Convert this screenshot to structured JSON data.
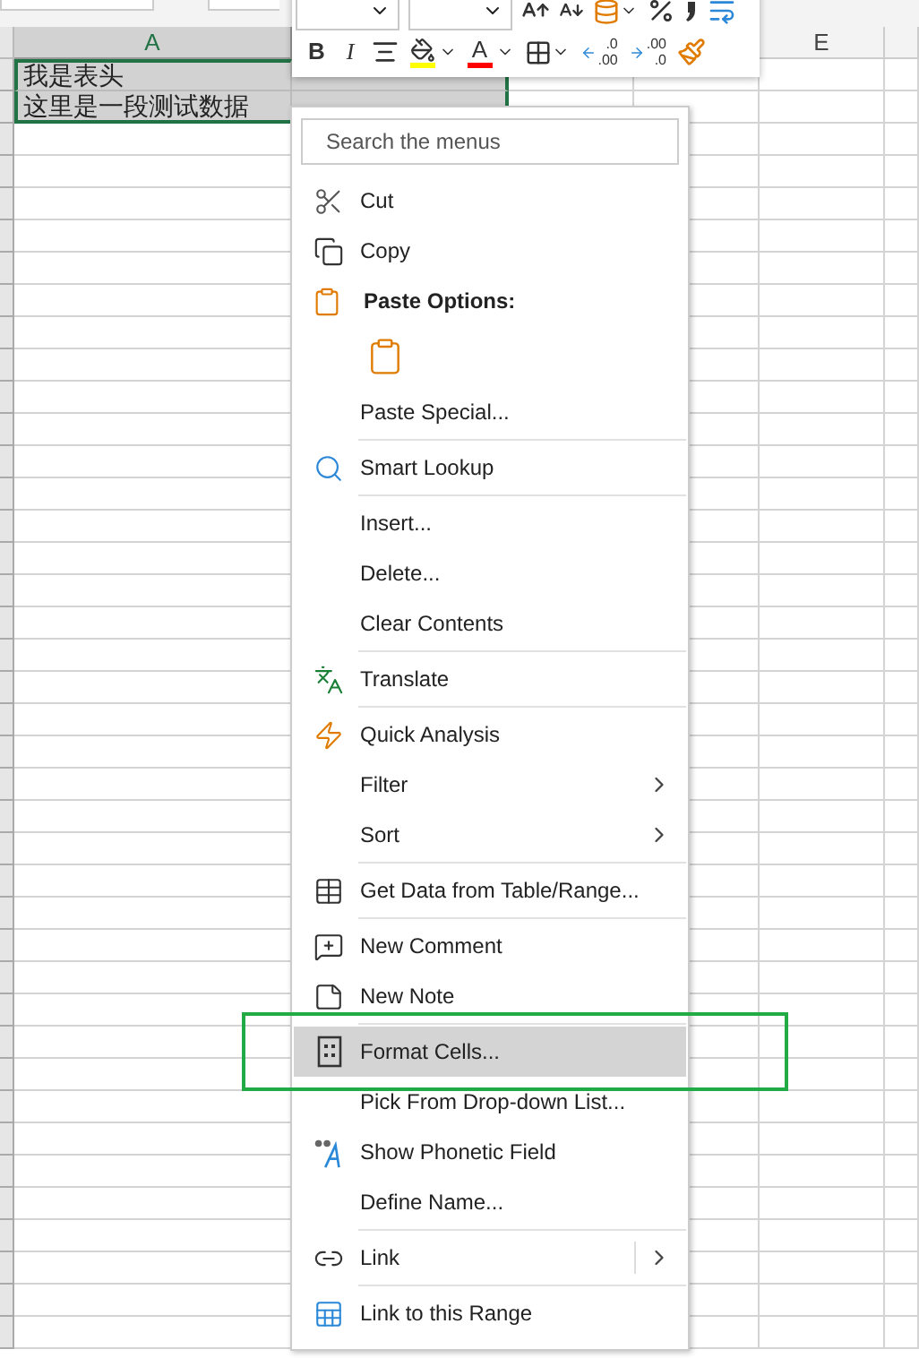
{
  "sheet": {
    "columns": [
      {
        "label": "A",
        "selected": true
      },
      {
        "label": "E",
        "selected": false
      }
    ],
    "rows": [
      {
        "cells": [
          "我是表头"
        ]
      },
      {
        "cells": [
          "这里是一段测试数据"
        ]
      }
    ]
  },
  "mini_toolbar": {
    "row_1": [
      {
        "kind": "dropdown"
      },
      {
        "kind": "dropdown"
      },
      {
        "kind": "grow"
      },
      {
        "kind": "shrink"
      },
      {
        "kind": "accounting"
      },
      {
        "kind": "percent"
      },
      {
        "kind": "comma"
      },
      {
        "kind": "wrap"
      }
    ],
    "row_2": [
      {
        "kind": "bold",
        "text": "B"
      },
      {
        "kind": "italic",
        "text": "I"
      },
      {
        "kind": "align"
      },
      {
        "kind": "fill",
        "color": "#ffff00"
      },
      {
        "kind": "font-color",
        "text": "A",
        "color": "#ff0000"
      },
      {
        "kind": "borders"
      },
      {
        "kind": "decimal-decrease",
        "upper": ".0",
        "lower": ".00"
      },
      {
        "kind": "decimal-increase",
        "upper": ".00",
        "lower": ".0"
      },
      {
        "kind": "painter"
      }
    ]
  },
  "context_menu": {
    "search": {
      "placeholder": "Search the menus"
    },
    "items": [
      {
        "kind": "item",
        "label": "Cut",
        "selected": false
      },
      {
        "kind": "item",
        "label": "Copy",
        "selected": false
      },
      {
        "kind": "header",
        "label": "Paste Options:"
      },
      {
        "kind": "paste-options"
      },
      {
        "kind": "item",
        "label": "Paste Special...",
        "selected": false
      },
      {
        "kind": "separator"
      },
      {
        "kind": "item",
        "label": "Smart Lookup",
        "selected": false
      },
      {
        "kind": "separator"
      },
      {
        "kind": "item",
        "label": "Insert...",
        "selected": false
      },
      {
        "kind": "item",
        "label": "Delete...",
        "selected": false
      },
      {
        "kind": "item",
        "label": "Clear Contents",
        "selected": false
      },
      {
        "kind": "separator"
      },
      {
        "kind": "item",
        "label": "Translate",
        "selected": false
      },
      {
        "kind": "separator"
      },
      {
        "kind": "item",
        "label": "Quick Analysis",
        "selected": false
      },
      {
        "kind": "item",
        "label": "Filter",
        "selected": false,
        "submenu": true
      },
      {
        "kind": "item",
        "label": "Sort",
        "selected": false,
        "submenu": true
      },
      {
        "kind": "separator"
      },
      {
        "kind": "item",
        "label": "Get Data from Table/Range...",
        "selected": false
      },
      {
        "kind": "separator"
      },
      {
        "kind": "item",
        "label": "New Comment",
        "selected": false
      },
      {
        "kind": "item",
        "label": "New Note",
        "selected": false
      },
      {
        "kind": "separator"
      },
      {
        "kind": "item",
        "label": "Format Cells...",
        "selected": true
      },
      {
        "kind": "item",
        "label": "Pick From Drop-down List...",
        "selected": false
      },
      {
        "kind": "item",
        "label": "Show Phonetic Field",
        "selected": false
      },
      {
        "kind": "item",
        "label": "Define Name...",
        "selected": false
      },
      {
        "kind": "separator"
      },
      {
        "kind": "item",
        "label": "Link",
        "selected": false,
        "submenu": true,
        "split": true
      },
      {
        "kind": "separator"
      },
      {
        "kind": "item",
        "label": "Link to this Range",
        "selected": false
      }
    ]
  }
}
